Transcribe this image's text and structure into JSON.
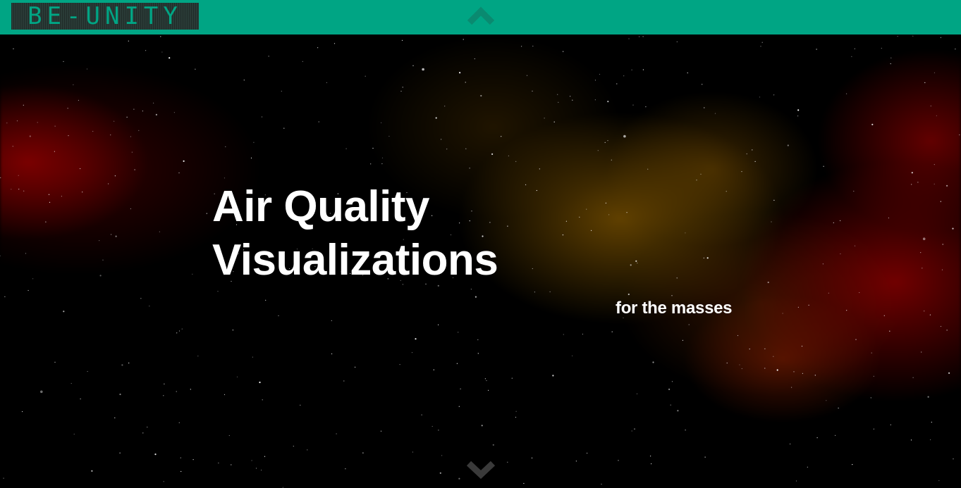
{
  "header": {
    "logo_text": "BE-UNITY",
    "bar_color": "#00a584",
    "scroll_up_icon": "chevron-up-icon"
  },
  "hero": {
    "title_line1": "Air Quality",
    "title_line2": "Visualizations",
    "subtitle": "for the masses",
    "scroll_down_icon": "chevron-down-icon"
  }
}
